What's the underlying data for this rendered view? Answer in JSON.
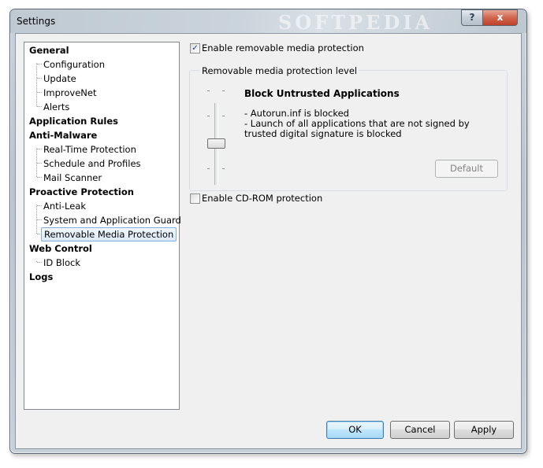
{
  "window": {
    "title": "Settings",
    "watermark": "SOFTPEDIA",
    "help_label": "?",
    "close_label": "x"
  },
  "tree": {
    "categories": [
      {
        "label": "General",
        "children": [
          "Configuration",
          "Update",
          "ImproveNet",
          "Alerts"
        ]
      },
      {
        "label": "Application Rules",
        "children": []
      },
      {
        "label": "Anti-Malware",
        "children": [
          "Real-Time Protection",
          "Schedule and Profiles",
          "Mail Scanner"
        ]
      },
      {
        "label": "Proactive Protection",
        "children": [
          "Anti-Leak",
          "System and Application Guard",
          "Removable Media Protection"
        ]
      },
      {
        "label": "Web Control",
        "children": [
          "ID Block"
        ]
      },
      {
        "label": "Logs",
        "children": []
      }
    ],
    "selected": "Removable Media Protection"
  },
  "options": {
    "enable_removable": {
      "label": "Enable removable media protection",
      "checked": true
    },
    "enable_cdrom": {
      "label": "Enable CD-ROM protection",
      "checked": false
    }
  },
  "level_group": {
    "title": "Removable media protection level",
    "level_name": "Block Untrusted Applications",
    "descriptions": [
      "- Autorun.inf is blocked",
      "- Launch of all applications that are not signed by trusted digital signature is blocked"
    ],
    "default_label": "Default",
    "slider_level": "2 of 4"
  },
  "buttons": {
    "ok": "OK",
    "cancel": "Cancel",
    "apply": "Apply"
  }
}
